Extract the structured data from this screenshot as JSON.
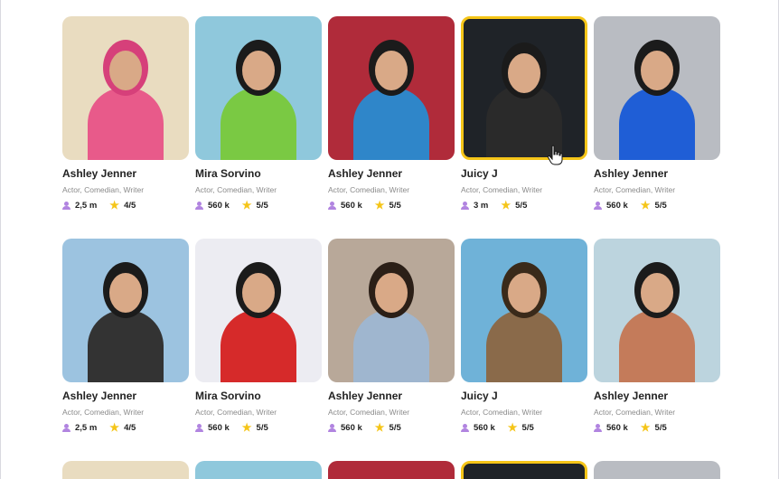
{
  "cards_row1": [
    {
      "name": "Ashley Jenner",
      "roles": "Actor, Comedian, Writer",
      "followers": "2,5 m",
      "rating": "4/5",
      "bg": "#e9dcc0",
      "accent": "#e85a8a",
      "hair": "#d6407a"
    },
    {
      "name": "Mira Sorvino",
      "roles": "Actor, Comedian, Writer",
      "followers": "560 k",
      "rating": "5/5",
      "bg": "#8fc8dc",
      "accent": "#7ac943",
      "hair": "#1b1b1b"
    },
    {
      "name": "Ashley Jenner",
      "roles": "Actor, Comedian, Writer",
      "followers": "560 k",
      "rating": "5/5",
      "bg": "#b02b3a",
      "accent": "#2f86c9",
      "hair": "#1b1b1b"
    },
    {
      "name": "Juicy J",
      "roles": "Actor, Comedian, Writer",
      "followers": "3 m",
      "rating": "5/5",
      "bg": "#1f2328",
      "accent": "#2a2a2a",
      "hair": "#1b1b1b",
      "selected": true
    },
    {
      "name": "Ashley Jenner",
      "roles": "Actor, Comedian, Writer",
      "followers": "560 k",
      "rating": "5/5",
      "bg": "#b9bcc2",
      "accent": "#1f5ed6",
      "hair": "#1b1b1b"
    }
  ],
  "cards_row2": [
    {
      "name": "Ashley Jenner",
      "roles": "Actor, Comedian, Writer",
      "followers": "2,5 m",
      "rating": "4/5",
      "bg": "#9cc3e0",
      "accent": "#333",
      "hair": "#1b1b1b"
    },
    {
      "name": "Mira Sorvino",
      "roles": "Actor, Comedian, Writer",
      "followers": "560 k",
      "rating": "5/5",
      "bg": "#ececf2",
      "accent": "#d62a2a",
      "hair": "#1b1b1b"
    },
    {
      "name": "Ashley Jenner",
      "roles": "Actor, Comedian, Writer",
      "followers": "560 k",
      "rating": "5/5",
      "bg": "#b8a899",
      "accent": "#9fb6cf",
      "hair": "#2b1f17"
    },
    {
      "name": "Juicy J",
      "roles": "Actor, Comedian, Writer",
      "followers": "560 k",
      "rating": "5/5",
      "bg": "#6fb2d8",
      "accent": "#8a6a4a",
      "hair": "#3a2a1a"
    },
    {
      "name": "Ashley Jenner",
      "roles": "Actor, Comedian, Writer",
      "followers": "560 k",
      "rating": "5/5",
      "bg": "#bcd4de",
      "accent": "#c47b5a",
      "hair": "#1b1b1b"
    }
  ],
  "partial_row": [
    {
      "bg": "#e9dcc0",
      "selected": false
    },
    {
      "bg": "#8fc8dc",
      "selected": false
    },
    {
      "bg": "#b02b3a",
      "selected": false
    },
    {
      "bg": "#1f2328",
      "selected": true
    },
    {
      "bg": "#b9bcc2",
      "selected": false
    }
  ],
  "colors": {
    "highlight": "#f5c518",
    "icon_purple": "#b184e0",
    "star": "#f5c518"
  }
}
